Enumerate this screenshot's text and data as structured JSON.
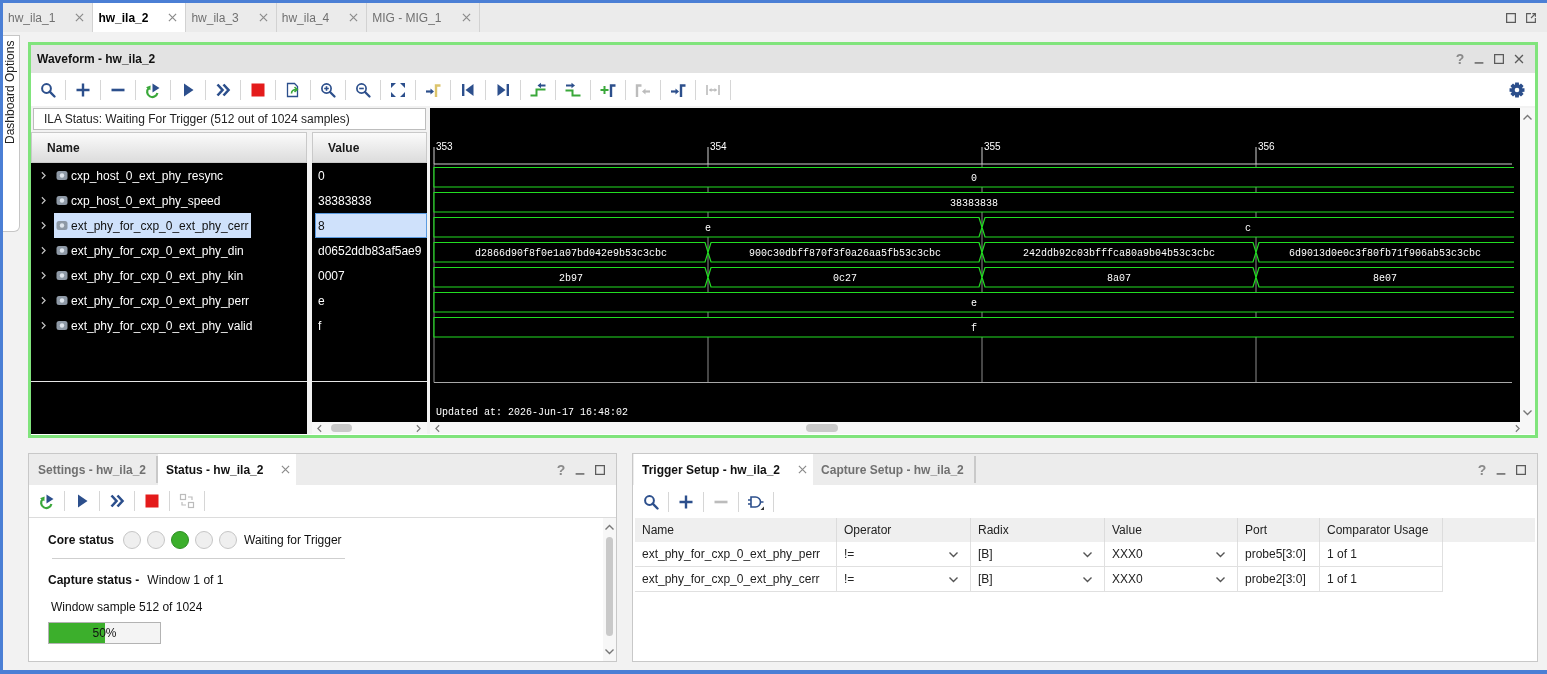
{
  "editor_tabs": [
    {
      "label": "hw_ila_1",
      "selected": false
    },
    {
      "label": "hw_ila_2",
      "selected": true
    },
    {
      "label": "hw_ila_3",
      "selected": false
    },
    {
      "label": "hw_ila_4",
      "selected": false
    },
    {
      "label": "MIG - MIG_1",
      "selected": false
    }
  ],
  "side_tab": {
    "label": "Dashboard Options"
  },
  "waveform_panel": {
    "title": "Waveform - hw_ila_2",
    "help": "?",
    "toolbar": [
      {
        "disabled": false
      },
      {
        "disabled": false
      },
      {
        "disabled": false
      },
      {
        "disabled": false
      },
      {
        "disabled": false
      },
      {
        "disabled": false
      },
      {
        "disabled": false
      },
      {
        "disabled": false
      },
      {
        "disabled": false
      },
      {
        "disabled": false
      },
      {
        "disabled": false
      },
      {
        "disabled": false
      },
      {
        "disabled": false
      },
      {
        "disabled": false
      },
      {
        "disabled": false
      },
      {
        "disabled": false
      },
      {
        "disabled": false
      },
      {
        "disabled": true
      },
      {
        "disabled": false
      },
      {
        "disabled": true
      }
    ],
    "ila_status": "ILA Status: Waiting For Trigger (512 out of 1024 samples)",
    "columns": [
      "Name",
      "Value"
    ],
    "signals": [
      {
        "name": "cxp_host_0_ext_phy_resync",
        "value": "0",
        "selected": false,
        "expanded": false,
        "wave": [
          "0"
        ]
      },
      {
        "name": "cxp_host_0_ext_phy_speed",
        "value": "38383838",
        "selected": false,
        "expanded": false,
        "wave": [
          "38383838"
        ]
      },
      {
        "name": "ext_phy_for_cxp_0_ext_phy_cerr",
        "value": "8",
        "selected": true,
        "expanded": false,
        "wave": [
          "e",
          "c"
        ]
      },
      {
        "name": "ext_phy_for_cxp_0_ext_phy_din",
        "value": "d0652ddb83af5ae9",
        "selected": false,
        "expanded": false,
        "wave": [
          "d2866d90f8f0e1a07bd042e9b53c3cbc",
          "900c30dbff870f3f0a26aa5fb53c3cbc",
          "242ddb92c03bfffca80a9b04b53c3cbc",
          "6d9013d0e0c3f80fb71f906ab53c3cbc"
        ]
      },
      {
        "name": "ext_phy_for_cxp_0_ext_phy_kin",
        "value": "0007",
        "selected": false,
        "expanded": false,
        "wave": [
          "2b97",
          "0c27",
          "8a07",
          "8e07"
        ]
      },
      {
        "name": "ext_phy_for_cxp_0_ext_phy_perr",
        "value": "e",
        "selected": false,
        "expanded": false,
        "wave": [
          "e"
        ]
      },
      {
        "name": "ext_phy_for_cxp_0_ext_phy_valid",
        "value": "f",
        "selected": false,
        "expanded": false,
        "wave": [
          "f"
        ]
      }
    ],
    "time_ticks": [
      "353",
      "354",
      "355",
      "356"
    ],
    "updated": "Updated at: 2026-Jun-17 16:48:02"
  },
  "status_panel": {
    "tabs": [
      {
        "label": "Settings - hw_ila_2",
        "selected": false
      },
      {
        "label": "Status - hw_ila_2",
        "selected": true
      }
    ],
    "help": "?",
    "toolbar": [
      {
        "disabled": false
      },
      {
        "disabled": false
      },
      {
        "disabled": false
      },
      {
        "disabled": false
      },
      {
        "disabled": true
      }
    ],
    "core_status": {
      "label": "Core status",
      "lights": [
        {
          "on": false
        },
        {
          "on": false
        },
        {
          "on": true
        },
        {
          "on": false
        },
        {
          "on": false
        }
      ],
      "text": "Waiting for Trigger"
    },
    "capture_status": {
      "label": "Capture status -",
      "text": "Window 1 of 1"
    },
    "window_sample": "Window sample 512 of 1024",
    "progress": {
      "level": 0.5,
      "reading": "50%"
    }
  },
  "trigger_panel": {
    "tabs": [
      {
        "label": "Trigger Setup - hw_ila_2",
        "selected": true
      },
      {
        "label": "Capture Setup - hw_ila_2",
        "selected": false
      }
    ],
    "help": "?",
    "toolbar": [
      {
        "disabled": false
      },
      {
        "disabled": false
      },
      {
        "disabled": true
      },
      {
        "disabled": false
      }
    ],
    "table": {
      "columns": [
        {
          "label": "Name",
          "kind": "text"
        },
        {
          "label": "Operator",
          "kind": "dropdown"
        },
        {
          "label": "Radix",
          "kind": "dropdown"
        },
        {
          "label": "Value",
          "kind": "dropdown"
        },
        {
          "label": "Port",
          "kind": "text"
        },
        {
          "label": "Comparator Usage",
          "kind": "text"
        }
      ],
      "rows": [
        {
          "cells": [
            "ext_phy_for_cxp_0_ext_phy_perr",
            "!=",
            "[B]",
            "XXX0",
            "probe5[3:0]",
            "1 of 1"
          ]
        },
        {
          "cells": [
            "ext_phy_for_cxp_0_ext_phy_cerr",
            "!=",
            "[B]",
            "XXX0",
            "probe2[3:0]",
            "1 of 1"
          ]
        }
      ]
    }
  }
}
